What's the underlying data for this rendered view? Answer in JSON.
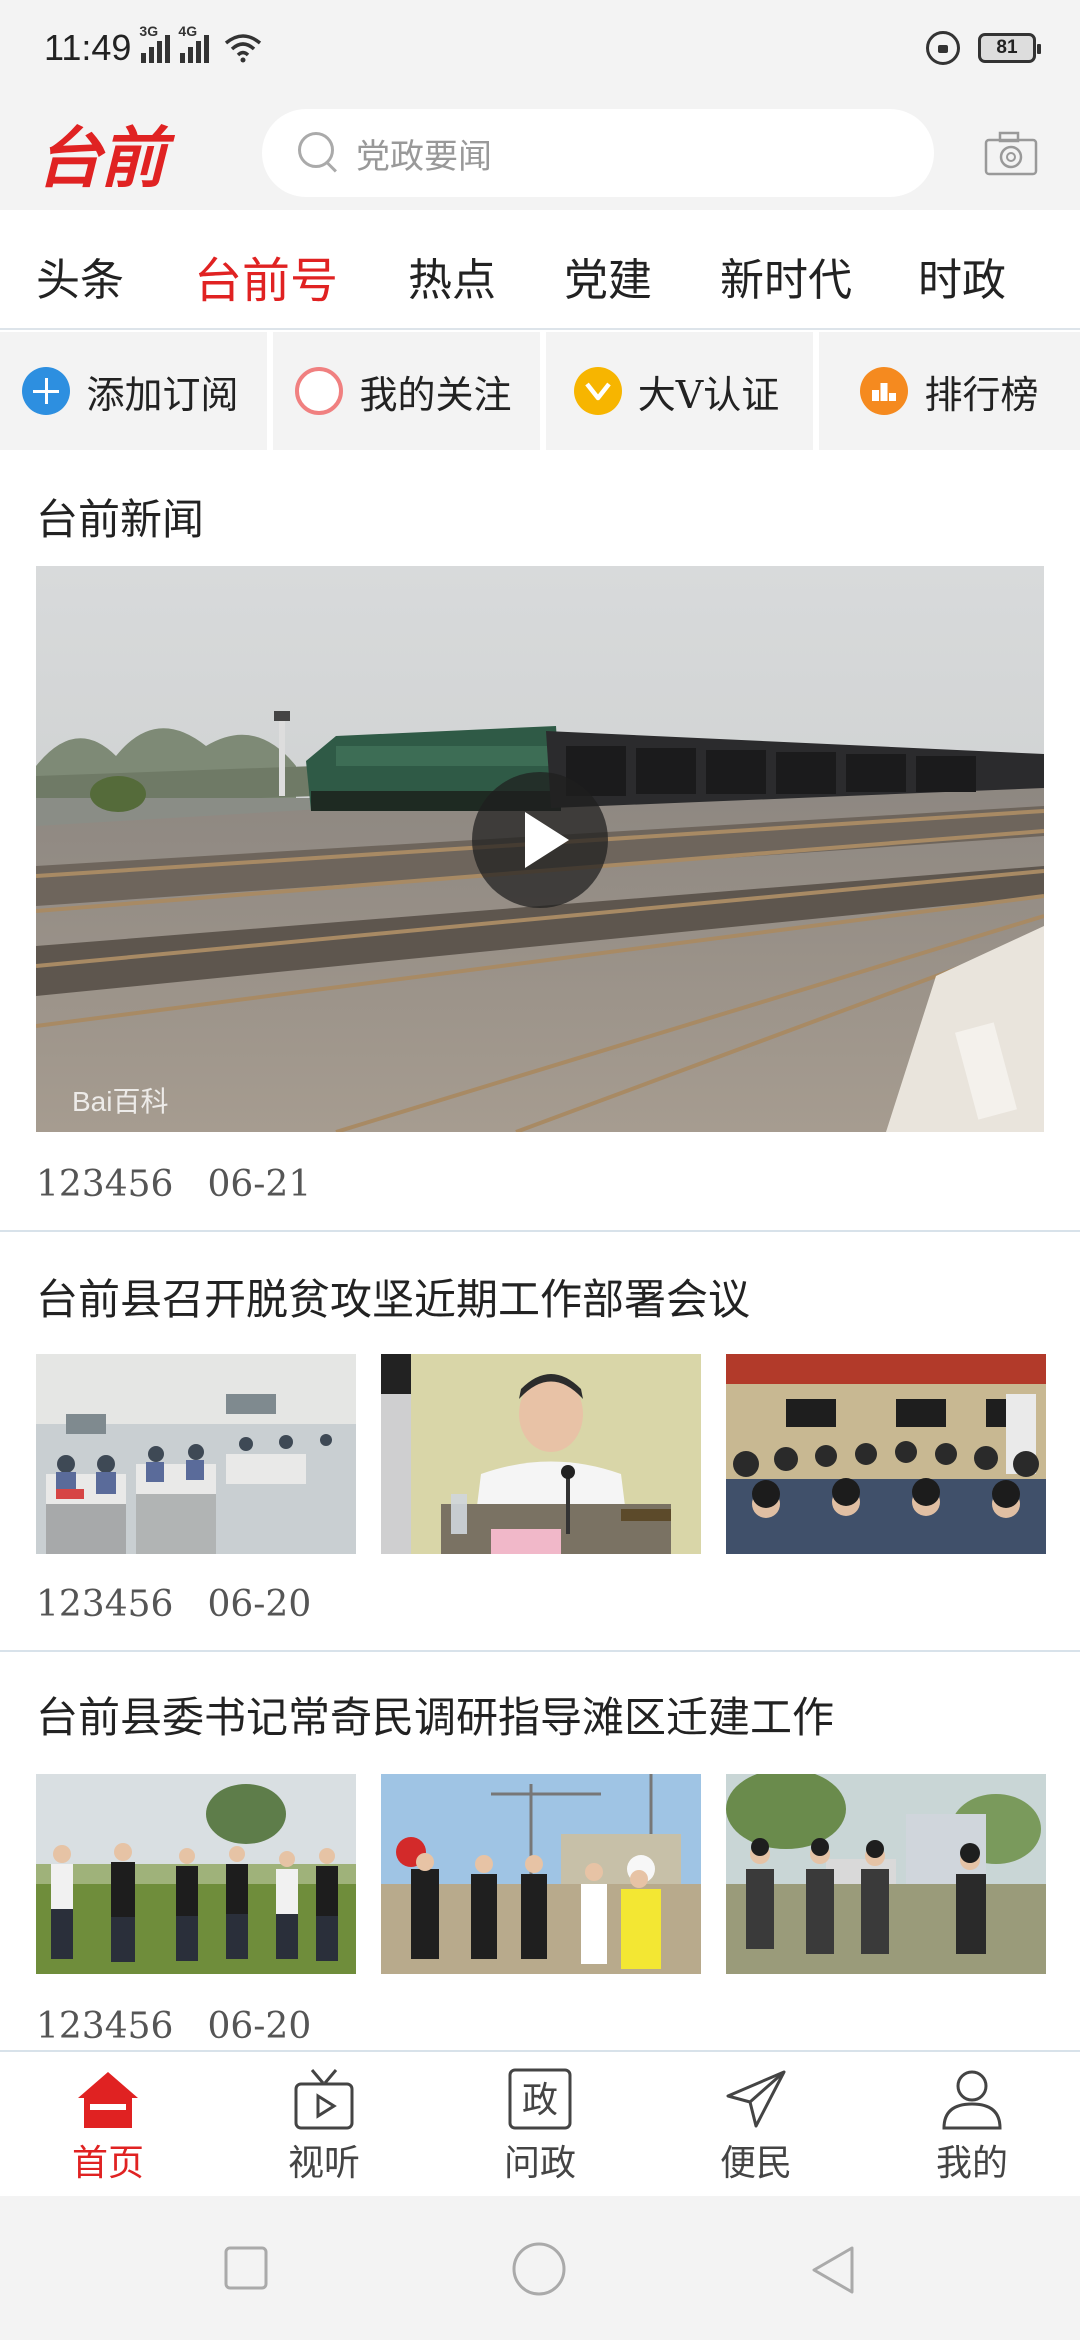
{
  "status_bar": {
    "time": "11:49",
    "net1": "3G",
    "net2": "4G",
    "battery": "81"
  },
  "header": {
    "logo": "台前",
    "search_placeholder": "党政要闻"
  },
  "categories": [
    {
      "label": "头条",
      "active": false
    },
    {
      "label": "台前号",
      "active": true
    },
    {
      "label": "热点",
      "active": false
    },
    {
      "label": "党建",
      "active": false
    },
    {
      "label": "新时代",
      "active": false
    },
    {
      "label": "时政",
      "active": false
    }
  ],
  "features": [
    {
      "label": "添加订阅",
      "icon": "plus-circle-icon"
    },
    {
      "label": "我的关注",
      "icon": "ring-icon"
    },
    {
      "label": "大V认证",
      "icon": "v-badge-icon"
    },
    {
      "label": "排行榜",
      "icon": "rank-icon"
    }
  ],
  "articles": [
    {
      "title": "台前新闻",
      "source": "123456",
      "date": "06-21",
      "media": "video",
      "watermark": "Bai百科"
    },
    {
      "title": "台前县召开脱贫攻坚近期工作部署会议",
      "source": "123456",
      "date": "06-20",
      "media": "three-images"
    },
    {
      "title": "台前县委书记常奇民调研指导滩区迁建工作",
      "source": "123456",
      "date": "06-20",
      "media": "three-images"
    }
  ],
  "bottom_nav": [
    {
      "label": "首页",
      "icon": "home-icon",
      "active": true
    },
    {
      "label": "视听",
      "icon": "tv-icon",
      "active": false
    },
    {
      "label": "问政",
      "icon": "zheng-icon",
      "glyph": "政",
      "active": false
    },
    {
      "label": "便民",
      "icon": "send-icon",
      "active": false
    },
    {
      "label": "我的",
      "icon": "user-icon",
      "active": false
    }
  ],
  "colors": {
    "accent": "#e02222",
    "blue": "#2d8fe0",
    "yellow": "#f7b500",
    "orange": "#f58a1f",
    "pink": "#f08080"
  }
}
